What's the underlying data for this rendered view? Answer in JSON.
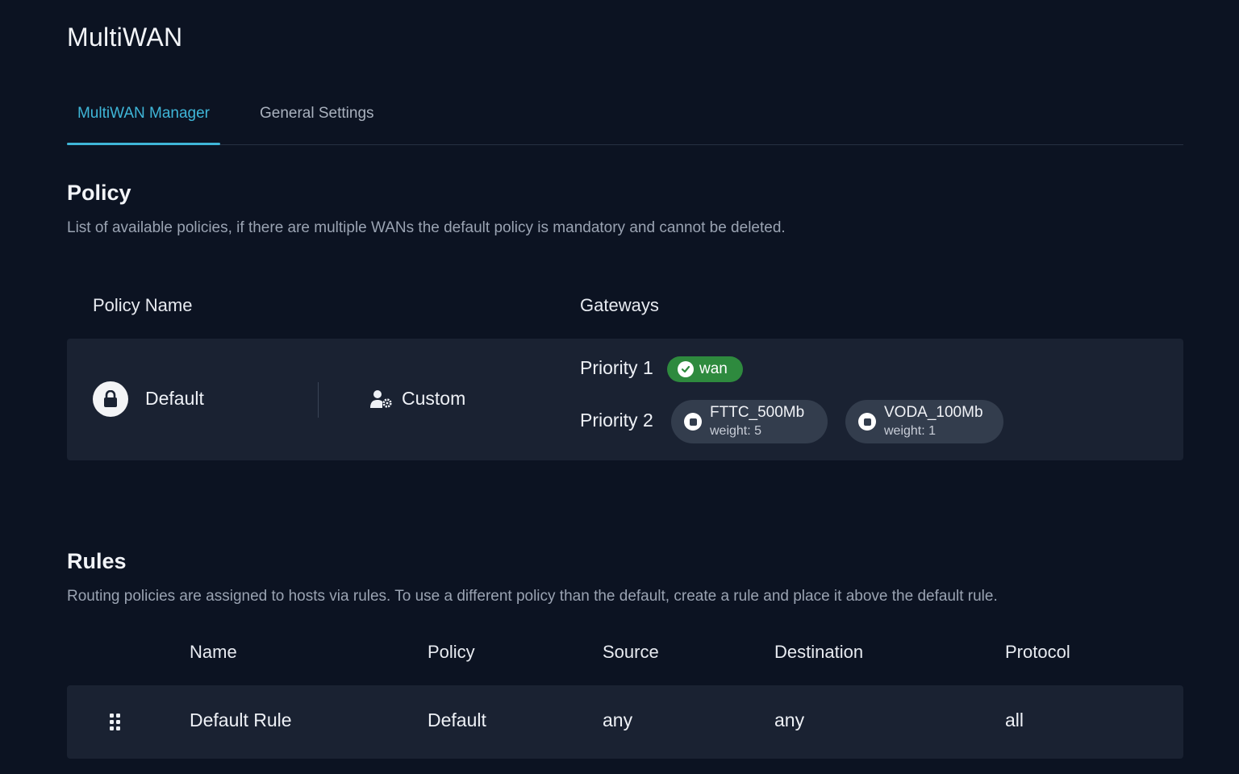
{
  "page": {
    "title": "MultiWAN"
  },
  "tabs": [
    {
      "label": "MultiWAN Manager",
      "active": true
    },
    {
      "label": "General Settings",
      "active": false
    }
  ],
  "policy": {
    "title": "Policy",
    "description": "List of available policies, if there are multiple WANs the default policy is mandatory and cannot be deleted.",
    "columns": {
      "name": "Policy Name",
      "gateways": "Gateways"
    },
    "rows": [
      {
        "icon": "lock-icon",
        "name": "Default",
        "type_icon": "user-settings-icon",
        "type": "Custom",
        "priorities": [
          {
            "label": "Priority 1",
            "gateways": [
              {
                "name": "wan",
                "status": "online",
                "icon": "check-circle-icon",
                "color": "#2e8a3e"
              }
            ]
          },
          {
            "label": "Priority 2",
            "gateways": [
              {
                "name": "FTTC_500Mb",
                "weight": "weight: 5",
                "icon": "stop-circle-icon"
              },
              {
                "name": "VODA_100Mb",
                "weight": "weight: 1",
                "icon": "stop-circle-icon"
              }
            ]
          }
        ]
      }
    ]
  },
  "rules": {
    "title": "Rules",
    "description": "Routing policies are assigned to hosts via rules. To use a different policy than the default, create a rule and place it above the default rule.",
    "columns": {
      "name": "Name",
      "policy": "Policy",
      "source": "Source",
      "destination": "Destination",
      "protocol": "Protocol"
    },
    "rows": [
      {
        "name": "Default Rule",
        "policy": "Default",
        "source": "any",
        "destination": "any",
        "protocol": "all",
        "icon": "drag-handle-icon"
      }
    ]
  },
  "colors": {
    "accent": "#3fb6d8",
    "background": "#0c1322",
    "card": "#1a2232",
    "online": "#2e8a3e"
  }
}
